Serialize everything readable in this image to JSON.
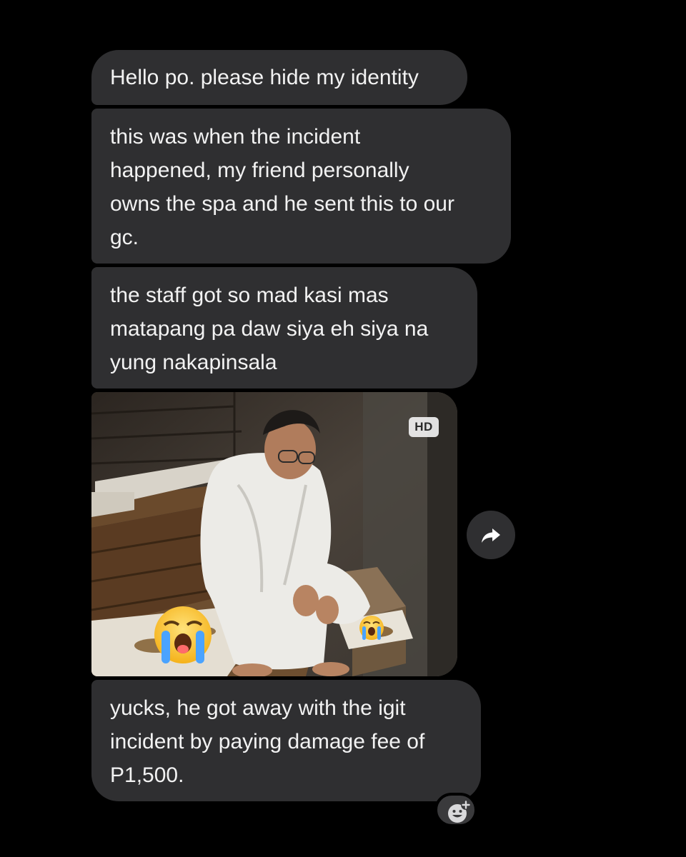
{
  "messages": [
    {
      "lines": [
        "Hello po. please hide my identity"
      ]
    },
    {
      "lines": [
        "this was when the incident",
        "happened, my friend personally",
        "owns the spa and he sent this to our",
        "gc."
      ]
    },
    {
      "lines": [
        "the staff got so mad kasi mas",
        "matapang pa daw siya eh siya na",
        "yung nakapinsala"
      ]
    },
    {
      "lines": [
        "yucks, he got away with the igit",
        "incident by paying damage fee of",
        "P1,500."
      ]
    }
  ],
  "photo": {
    "badge": "HD",
    "description_icon": "photo-image",
    "overlays": [
      "loudly-crying-face-icon",
      "loudly-crying-face-icon"
    ]
  },
  "icons": {
    "forward": "forward-arrow-icon",
    "react": "add-reaction-icon"
  },
  "colors": {
    "background": "#000000",
    "bubble": "#2f2f31",
    "text": "#f2f2f2"
  }
}
